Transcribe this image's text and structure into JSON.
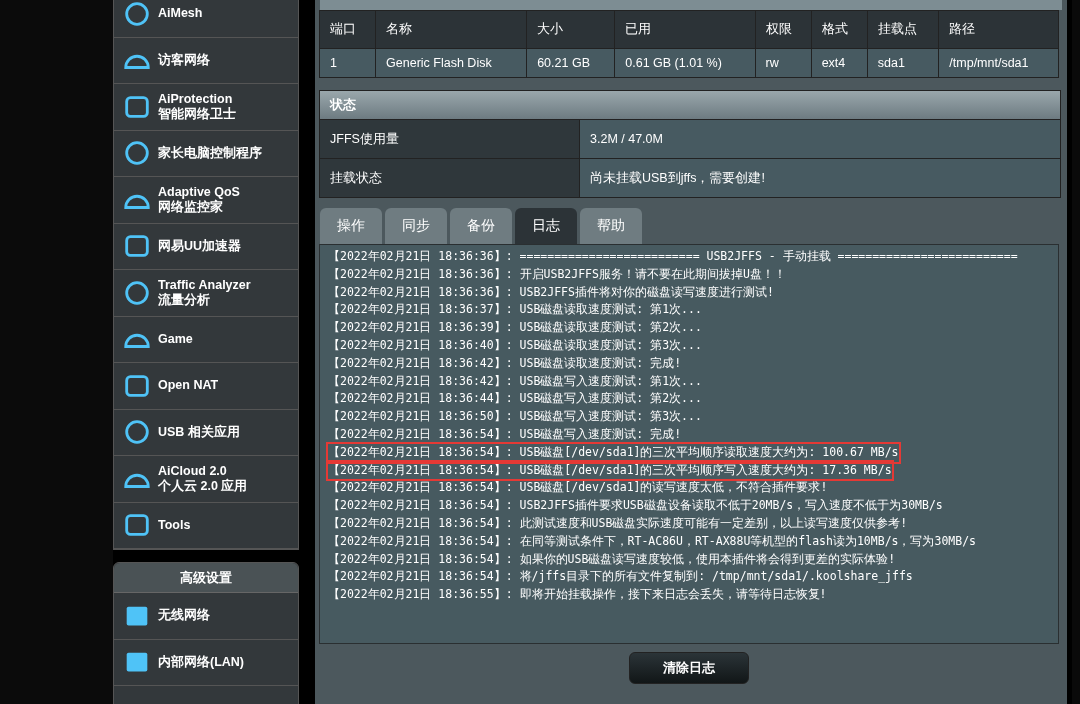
{
  "sidebar": {
    "items": [
      {
        "title": "AiMesh"
      },
      {
        "title": "访客网络"
      },
      {
        "title": "AiProtection",
        "subtitle": "智能网络卫士"
      },
      {
        "title": "家长电脑控制程序"
      },
      {
        "title": "Adaptive QoS",
        "subtitle": "网络监控家"
      },
      {
        "title": "网易UU加速器"
      },
      {
        "title": "Traffic Analyzer",
        "subtitle": "流量分析"
      },
      {
        "title": "Game"
      },
      {
        "title": "Open NAT"
      },
      {
        "title": "USB 相关应用"
      },
      {
        "title": "AiCloud 2.0",
        "subtitle": "个人云 2.0 应用"
      },
      {
        "title": "Tools"
      }
    ],
    "advanced": {
      "header": "高级设置",
      "items": [
        {
          "title": "无线网络"
        },
        {
          "title": "内部网络(LAN)"
        }
      ]
    }
  },
  "disk_table": {
    "columns": [
      "端口",
      "名称",
      "大小",
      "已用",
      "权限",
      "格式",
      "挂载点",
      "路径"
    ],
    "rows": [
      [
        "1",
        "Generic Flash Disk",
        "60.21 GB",
        "0.61 GB (1.01 %)",
        "rw",
        "ext4",
        "sda1",
        "/tmp/mnt/sda1"
      ]
    ]
  },
  "status": {
    "header": "状态",
    "rows": [
      {
        "label": "JFFS使用量",
        "value": "3.2M / 47.0M"
      },
      {
        "label": "挂载状态",
        "value": "尚未挂载USB到jffs，需要创建!"
      }
    ]
  },
  "tabs": [
    {
      "label": "操作",
      "selected": false
    },
    {
      "label": "同步",
      "selected": false
    },
    {
      "label": "备份",
      "selected": false
    },
    {
      "label": "日志",
      "selected": true
    },
    {
      "label": "帮助",
      "selected": false
    }
  ],
  "log": [
    {
      "time": "【2022年02月21日 18:36:36】:",
      "message": "========================== USB2JFFS - 手动挂载 ==========================",
      "highlighted": false
    },
    {
      "time": "【2022年02月21日 18:36:36】:",
      "message": "开启USB2JFFS服务！请不要在此期间拔掉U盘！！",
      "highlighted": false
    },
    {
      "time": "【2022年02月21日 18:36:36】:",
      "message": "USB2JFFS插件将对你的磁盘读写速度进行测试!",
      "highlighted": false
    },
    {
      "time": "【2022年02月21日 18:36:37】:",
      "message": "USB磁盘读取速度测试: 第1次...",
      "highlighted": false
    },
    {
      "time": "【2022年02月21日 18:36:39】:",
      "message": "USB磁盘读取速度测试: 第2次...",
      "highlighted": false
    },
    {
      "time": "【2022年02月21日 18:36:40】:",
      "message": "USB磁盘读取速度测试: 第3次...",
      "highlighted": false
    },
    {
      "time": "【2022年02月21日 18:36:42】:",
      "message": "USB磁盘读取速度测试: 完成!",
      "highlighted": false
    },
    {
      "time": "【2022年02月21日 18:36:42】:",
      "message": "USB磁盘写入速度测试: 第1次...",
      "highlighted": false
    },
    {
      "time": "【2022年02月21日 18:36:44】:",
      "message": "USB磁盘写入速度测试: 第2次...",
      "highlighted": false
    },
    {
      "time": "【2022年02月21日 18:36:50】:",
      "message": "USB磁盘写入速度测试: 第3次...",
      "highlighted": false
    },
    {
      "time": "【2022年02月21日 18:36:54】:",
      "message": "USB磁盘写入速度测试: 完成!",
      "highlighted": false
    },
    {
      "time": "【2022年02月21日 18:36:54】:",
      "message": "USB磁盘[/dev/sda1]的三次平均顺序读取速度大约为: 100.67 MB/s",
      "highlighted": true
    },
    {
      "time": "【2022年02月21日 18:36:54】:",
      "message": "USB磁盘[/dev/sda1]的三次平均顺序写入速度大约为: 17.36 MB/s",
      "highlighted": true
    },
    {
      "time": "【2022年02月21日 18:36:54】:",
      "message": "USB磁盘[/dev/sda1]的读写速度太低，不符合插件要求!",
      "highlighted": false
    },
    {
      "time": "【2022年02月21日 18:36:54】:",
      "message": "USB2JFFS插件要求USB磁盘设备读取不低于20MB/s，写入速度不低于为30MB/s",
      "highlighted": false
    },
    {
      "time": "【2022年02月21日 18:36:54】:",
      "message": "此测试速度和USB磁盘实际速度可能有一定差别，以上读写速度仅供参考!",
      "highlighted": false
    },
    {
      "time": "【2022年02月21日 18:36:54】:",
      "message": "在同等测试条件下，RT-AC86U，RT-AX88U等机型的flash读为10MB/s，写为30MB/s",
      "highlighted": false
    },
    {
      "time": "【2022年02月21日 18:36:54】:",
      "message": "如果你的USB磁盘读写速度较低，使用本插件将会得到更差的实际体验!",
      "highlighted": false
    },
    {
      "time": "【2022年02月21日 18:36:54】:",
      "message": "将/jffs目录下的所有文件复制到: /tmp/mnt/sda1/.koolshare_jffs",
      "highlighted": false
    },
    {
      "time": "【2022年02月21日 18:36:55】:",
      "message": "即将开始挂载操作，接下来日志会丢失，请等待日志恢复!",
      "highlighted": false
    }
  ],
  "clear_button": "清除日志"
}
